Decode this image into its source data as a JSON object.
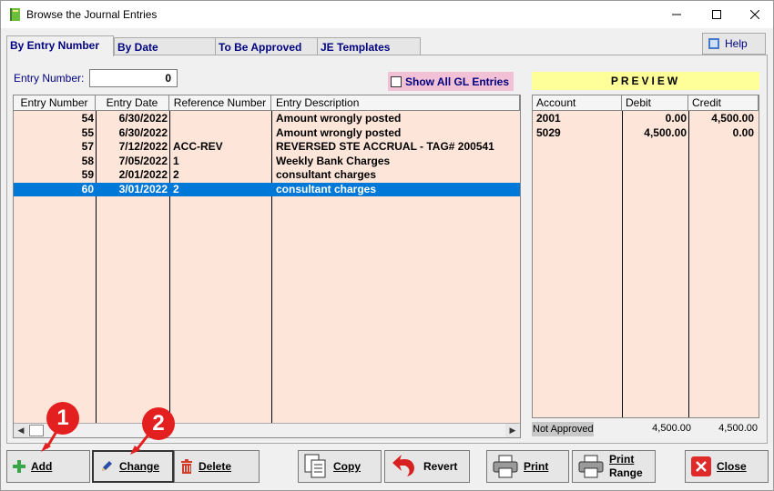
{
  "window": {
    "title": "Browse the Journal Entries"
  },
  "tabs": [
    {
      "label": "By Entry Number"
    },
    {
      "label": "By Date"
    },
    {
      "label": "To Be Approved"
    },
    {
      "label": "JE Templates"
    }
  ],
  "help": {
    "label": "Help"
  },
  "entry_number": {
    "label": "Entry Number:",
    "value": "0"
  },
  "show_all": {
    "label": "Show All GL Entries",
    "checked": false
  },
  "grid": {
    "columns": [
      "Entry Number",
      "Entry Date",
      "Reference Number",
      "Entry Description"
    ],
    "rows": [
      {
        "num": "54",
        "date": "6/30/2022",
        "ref": "",
        "desc": "Amount wrongly posted"
      },
      {
        "num": "55",
        "date": "6/30/2022",
        "ref": "",
        "desc": "Amount wrongly posted"
      },
      {
        "num": "57",
        "date": "7/12/2022",
        "ref": "ACC-REV",
        "desc": "REVERSED STE ACCRUAL - TAG# 200541"
      },
      {
        "num": "58",
        "date": "7/05/2022",
        "ref": "1",
        "desc": "Weekly Bank Charges"
      },
      {
        "num": "59",
        "date": "2/01/2022",
        "ref": "2",
        "desc": "consultant charges"
      },
      {
        "num": "60",
        "date": "3/01/2022",
        "ref": "2",
        "desc": "consultant charges"
      }
    ],
    "selected_index": 5
  },
  "preview": {
    "title": "PREVIEW",
    "columns": [
      "Account",
      "Debit",
      "Credit"
    ],
    "rows": [
      {
        "account": "2001",
        "debit": "0.00",
        "credit": "4,500.00"
      },
      {
        "account": "5029",
        "debit": "4,500.00",
        "credit": "0.00"
      }
    ],
    "status": "Not Approved",
    "total_debit": "4,500.00",
    "total_credit": "4,500.00"
  },
  "buttons": {
    "add": "Add",
    "change": "Change",
    "delete": "Delete",
    "copy": "Copy",
    "revert": "Revert",
    "print": "Print",
    "print_range_1": "Print",
    "print_range_2": "Range",
    "close": "Close"
  },
  "annotations": {
    "badge1": "1",
    "badge2": "2"
  },
  "colors": {
    "accent": "#0078d7",
    "badge": "#e41f1f",
    "grid_bg": "#fde6d9",
    "preview_title_bg": "#ffff99",
    "show_all_bg": "#f2c1d5"
  }
}
